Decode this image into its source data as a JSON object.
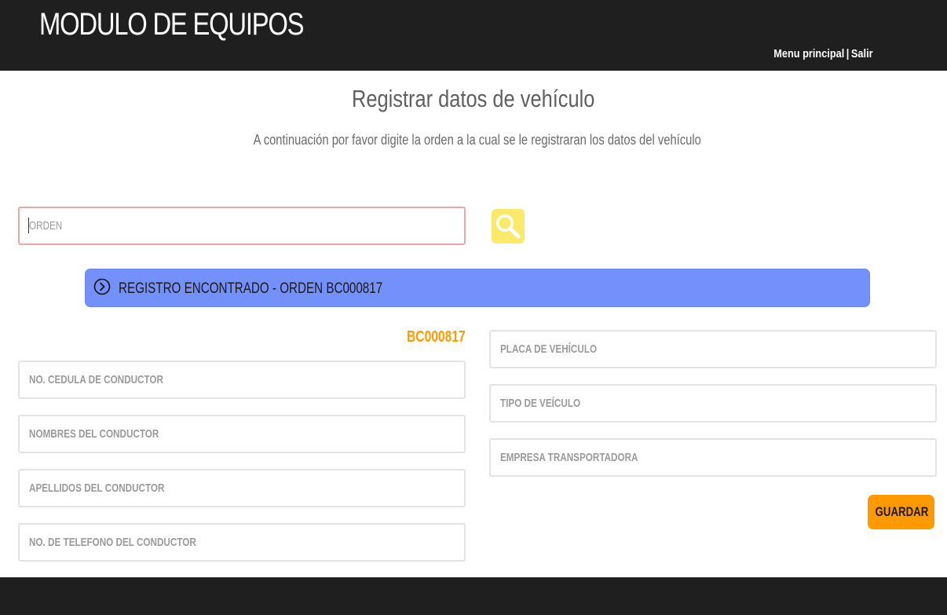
{
  "header": {
    "app_title": "MODULO DE EQUIPOS",
    "nav": {
      "menu_principal": "Menu principal",
      "separator": "|",
      "salir": "Salir"
    }
  },
  "main": {
    "title": "Registrar datos de vehículo",
    "subtitle": "A continuación por favor digite la orden a la cual se le registraran los datos del vehículo",
    "orden_input": {
      "placeholder": "ORDEN",
      "value": ""
    },
    "search_button": {
      "icon": "search-icon",
      "color": "#fbe96a"
    },
    "alert": {
      "icon": "circle-chevron-right-icon",
      "text": "REGISTRO ENCONTRADO - ORDEN BC000817",
      "color": "#7490fb"
    },
    "orden_code": "BC000817",
    "left_fields": [
      {
        "placeholder": "NO. CEDULA DE CONDUCTOR",
        "value": ""
      },
      {
        "placeholder": "NOMBRES DEL CONDUCTOR",
        "value": ""
      },
      {
        "placeholder": "APELLIDOS DEL CONDUCTOR",
        "value": ""
      },
      {
        "placeholder": "NO. DE TELEFONO DEL CONDUCTOR",
        "value": ""
      }
    ],
    "right_fields": [
      {
        "placeholder": "PLACA DE VEHÍCULO",
        "value": ""
      },
      {
        "placeholder": "TIPO DE VEÍCULO",
        "value": ""
      },
      {
        "placeholder": "EMPRESA TRANSPORTADORA",
        "value": ""
      }
    ],
    "save_button": {
      "label": "GUARDAR",
      "color": "#ff9900"
    }
  },
  "colors": {
    "header_bg": "#1f1f1f",
    "accent_orange": "#ff9a00"
  }
}
